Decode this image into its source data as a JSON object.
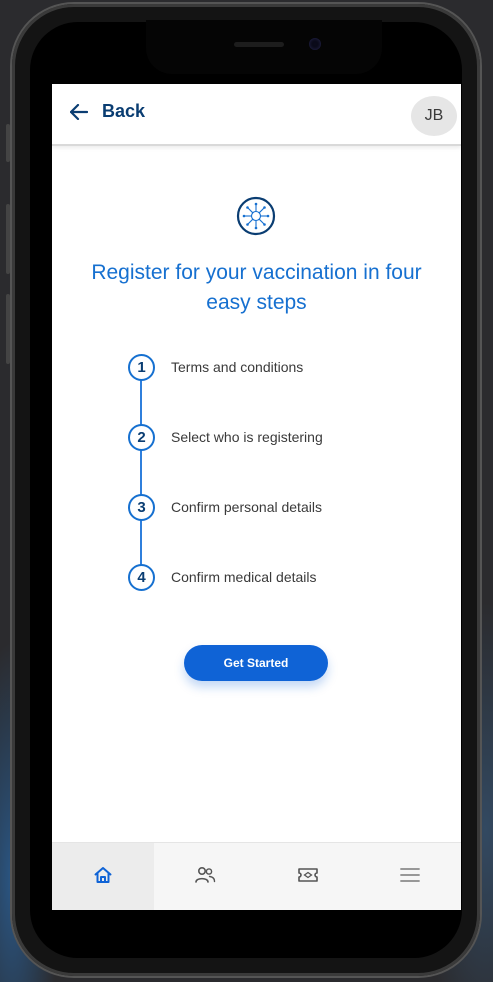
{
  "header": {
    "back_label": "Back",
    "avatar_initials": "JB"
  },
  "hero": {
    "icon": "virus-icon",
    "title": "Register for your vaccination in four easy steps"
  },
  "steps": [
    {
      "number": "1",
      "label": "Terms and conditions"
    },
    {
      "number": "2",
      "label": "Select who is registering"
    },
    {
      "number": "3",
      "label": "Confirm personal details"
    },
    {
      "number": "4",
      "label": "Confirm medical details"
    }
  ],
  "cta": {
    "label": "Get Started"
  },
  "tabbar": {
    "tabs": [
      {
        "icon": "home-icon",
        "active": true
      },
      {
        "icon": "people-icon",
        "active": false
      },
      {
        "icon": "ticket-icon",
        "active": false
      },
      {
        "icon": "menu-icon",
        "active": false
      }
    ]
  },
  "colors": {
    "primary": "#0f63d6",
    "title": "#1670d0",
    "navy": "#0a3d72"
  }
}
